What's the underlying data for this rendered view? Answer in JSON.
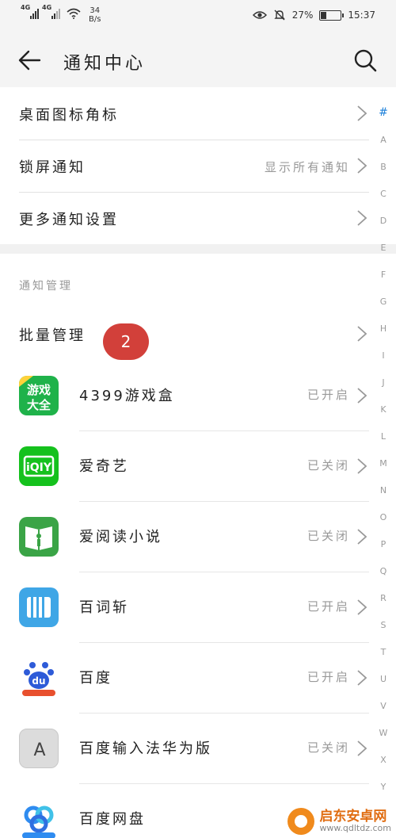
{
  "status_bar": {
    "net1": "4G",
    "net2": "4G",
    "speed_value": "34",
    "speed_unit": "B/s",
    "battery": "27%",
    "battery_level": 0.27,
    "time": "15:37"
  },
  "header": {
    "title": "通知中心"
  },
  "settings": [
    {
      "label": "桌面图标角标",
      "value": ""
    },
    {
      "label": "锁屏通知",
      "value": "显示所有通知"
    },
    {
      "label": "更多通知设置",
      "value": ""
    }
  ],
  "section": {
    "title": "通知管理",
    "batch_label": "批量管理",
    "badge": "2"
  },
  "apps": [
    {
      "name": "4399游戏盒",
      "state": "已开启",
      "icon": "4399-youxi-daquan-icon",
      "icon_text": "游戏大全",
      "color": "#1fb24a"
    },
    {
      "name": "爱奇艺",
      "state": "已关闭",
      "icon": "iqiyi-icon",
      "icon_text": "iQIY",
      "color": "#15c11d"
    },
    {
      "name": "爱阅读小说",
      "state": "已关闭",
      "icon": "book-reader-icon",
      "icon_text": "",
      "color": "#3aa446"
    },
    {
      "name": "百词斩",
      "state": "已开启",
      "icon": "baicizhan-icon",
      "icon_text": "",
      "color": "#3fa6e6"
    },
    {
      "name": "百度",
      "state": "已开启",
      "icon": "baidu-paw-icon",
      "icon_text": "du",
      "color": "#2e5bd8"
    },
    {
      "name": "百度输入法华为版",
      "state": "已关闭",
      "icon": "baidu-input-icon",
      "icon_text": "A",
      "color": "#d9d9d9"
    },
    {
      "name": "百度网盘",
      "state": "",
      "icon": "baidu-netdisk-icon",
      "icon_text": "",
      "color": "#2f8cf0"
    }
  ],
  "alphabet": [
    "#",
    "A",
    "B",
    "C",
    "D",
    "E",
    "F",
    "G",
    "H",
    "I",
    "J",
    "K",
    "L",
    "M",
    "N",
    "O",
    "P",
    "Q",
    "R",
    "S",
    "T",
    "U",
    "V",
    "W",
    "X",
    "Y"
  ],
  "watermark": {
    "name": "启东安卓网",
    "url": "www.qdltdz.com"
  },
  "colors": {
    "accent": "#1b7fd9",
    "badge": "#d2403a"
  }
}
